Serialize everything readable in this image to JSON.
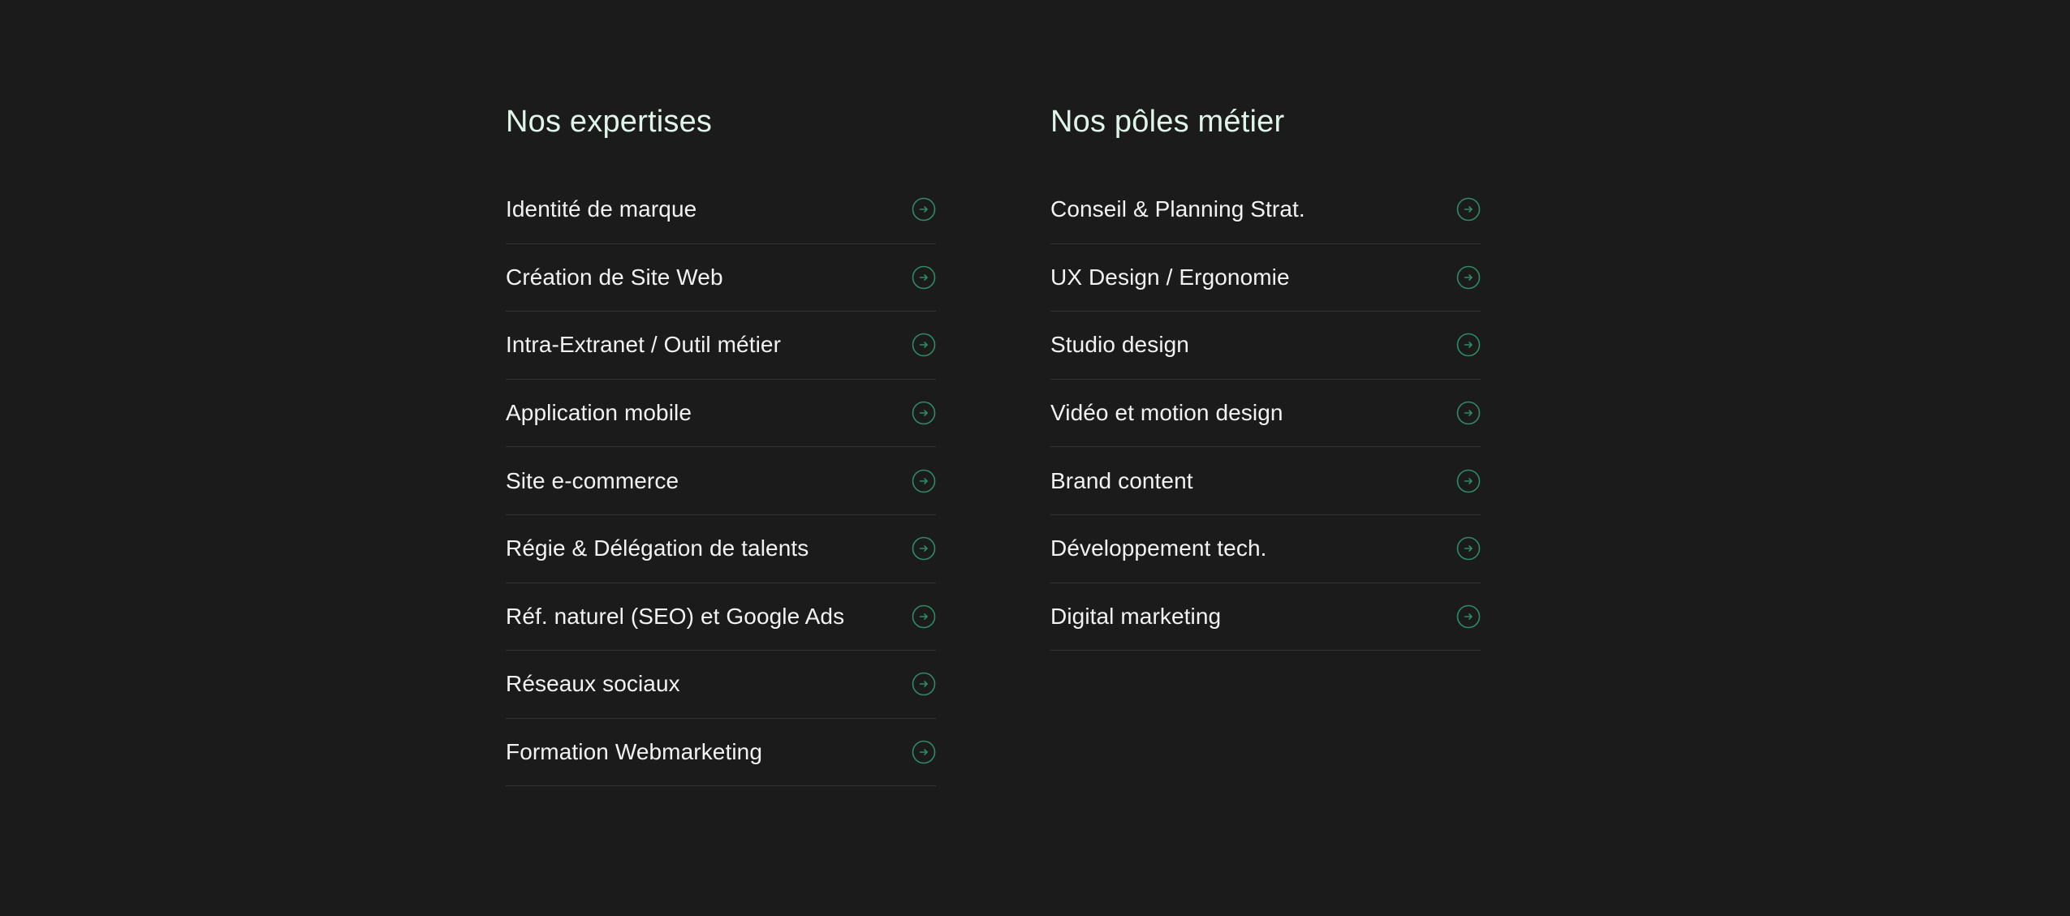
{
  "accent_color": "#2f8a66",
  "background_color": "#1b1b1b",
  "expertises": {
    "title": "Nos expertises",
    "items": [
      {
        "label": "Identité de marque",
        "icon": "arrow-right-circle-icon"
      },
      {
        "label": "Création de Site Web",
        "icon": "arrow-right-circle-icon"
      },
      {
        "label": "Intra-Extranet / Outil métier",
        "icon": "arrow-right-circle-icon"
      },
      {
        "label": "Application mobile",
        "icon": "arrow-right-circle-icon"
      },
      {
        "label": "Site e-commerce",
        "icon": "arrow-right-circle-icon"
      },
      {
        "label": "Régie & Délégation de talents",
        "icon": "arrow-right-circle-icon"
      },
      {
        "label": "Réf. naturel (SEO) et Google Ads",
        "icon": "arrow-right-circle-icon"
      },
      {
        "label": "Réseaux sociaux",
        "icon": "arrow-right-circle-icon"
      },
      {
        "label": "Formation Webmarketing",
        "icon": "arrow-right-circle-icon"
      }
    ]
  },
  "poles": {
    "title": "Nos pôles métier",
    "items": [
      {
        "label": "Conseil & Planning Strat.",
        "icon": "arrow-right-circle-icon"
      },
      {
        "label": "UX Design / Ergonomie",
        "icon": "arrow-right-circle-icon"
      },
      {
        "label": "Studio design",
        "icon": "arrow-right-circle-icon"
      },
      {
        "label": "Vidéo et motion design",
        "icon": "arrow-right-circle-icon"
      },
      {
        "label": "Brand content",
        "icon": "arrow-right-circle-icon"
      },
      {
        "label": "Développement tech.",
        "icon": "arrow-right-circle-icon"
      },
      {
        "label": "Digital marketing",
        "icon": "arrow-right-circle-icon"
      }
    ]
  }
}
